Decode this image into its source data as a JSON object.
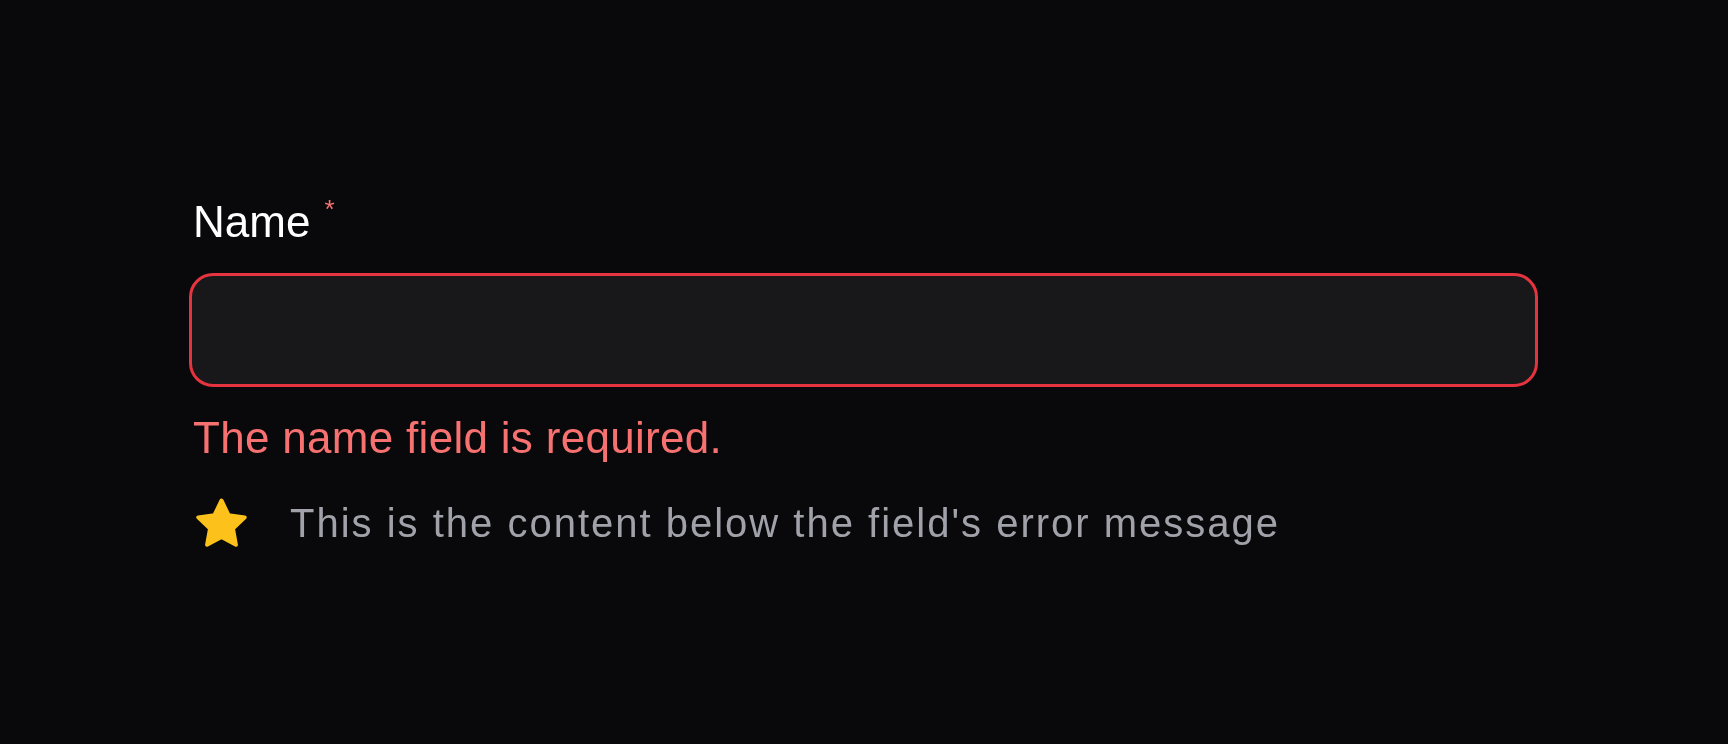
{
  "field": {
    "label": "Name",
    "required": true,
    "required_mark": "*",
    "invalid": true,
    "error": "The name field is required."
  },
  "note": {
    "text": "This is the content below the field's error message"
  }
}
